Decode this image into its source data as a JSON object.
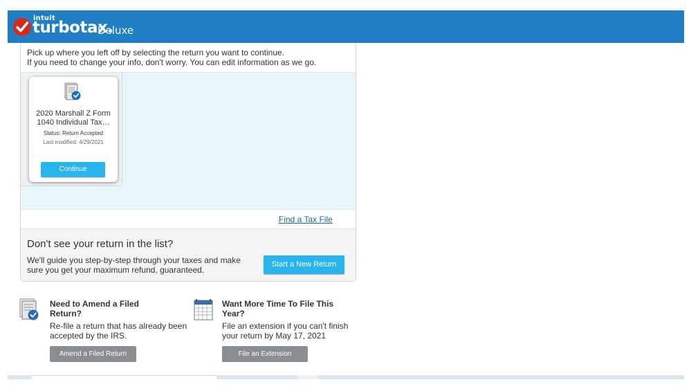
{
  "header": {
    "brand_parent": "intuit",
    "brand": "turbotax.",
    "edition": "Deluxe",
    "bg_color": "#1f7ec4",
    "check_color": "#d52b1e"
  },
  "intro": {
    "line1": "Pick up where you left off by selecting the return you want to continue.",
    "line2": "If you need to change your info, don't worry.  You can edit information as we go."
  },
  "returns": [
    {
      "icon": "tax-document-check-icon",
      "title_line1": "2020 Marshall Z Form",
      "title_line2": "1040  Individual Tax…",
      "status": "Status: Return Accepted",
      "modified": "Last modified: 4/29/2021",
      "button_label": "Continue"
    }
  ],
  "find_link": "Find a Tax File",
  "not_listed": {
    "title": "Don't see your return in the list?",
    "text_line1": "We'll guide you step-by-step through your taxes and make",
    "text_line2": "sure you get your maximum refund, guaranteed.",
    "button_label": "Start a New Return"
  },
  "amend": {
    "icon": "amend-document-icon",
    "title_line1": "Need to Amend a Filed",
    "title_line2": "Return?",
    "text_line1": "Re-file a return that has already been",
    "text_line2": "accepted by the IRS.",
    "button_label": "Amend a Filed Return"
  },
  "extension": {
    "icon": "calendar-icon",
    "title_line1": "Want More Time To File This",
    "title_line2": "Year?",
    "text_line1": "File an extension if you can't finish",
    "text_line2": "your return by May 17, 2021",
    "button_label": "File an Extension"
  },
  "colors": {
    "accent": "#2ab4ee",
    "link": "#1468a5",
    "gray_button": "#8a8d91",
    "panel": "#e8f6fc"
  }
}
